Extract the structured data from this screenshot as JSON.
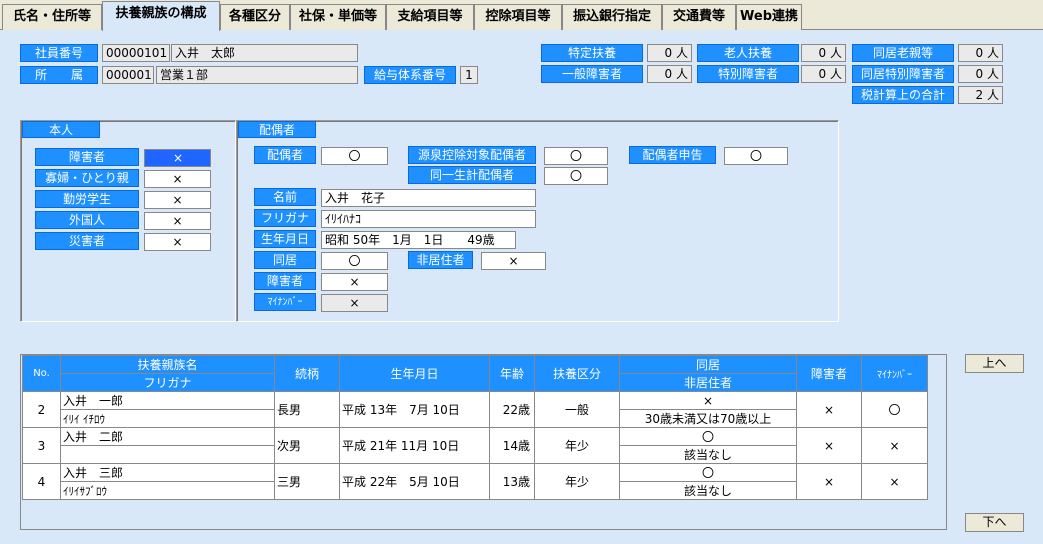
{
  "tabs": [
    "氏名・住所等",
    "扶養親族の構成",
    "各種区分",
    "社保・単価等",
    "支給項目等",
    "控除項目等",
    "振込銀行指定",
    "交通費等",
    "Web連携"
  ],
  "header": {
    "emp_no_label": "社員番号",
    "emp_no": "00000101",
    "emp_name": "入井　太郎",
    "dept_label": "所　　属",
    "dept_code": "000001",
    "dept_name": "営業１部",
    "pay_system_label": "給与体系番号",
    "pay_system": "1"
  },
  "counts": {
    "tokutei_label": "特定扶養",
    "tokutei": "0 人",
    "rojin_label": "老人扶養",
    "rojin": "0 人",
    "dokyo_rojin_label": "同居老親等",
    "dokyo_rojin": "0 人",
    "ippan_shogai_label": "一般障害者",
    "ippan_shogai": "0 人",
    "tokubetsu_shogai_label": "特別障害者",
    "tokubetsu_shogai": "0 人",
    "dokyo_tokubetsu_label": "同居特別障害者",
    "dokyo_tokubetsu": "0 人",
    "total_label": "税計算上の合計",
    "total": "2 人"
  },
  "honnin": {
    "title": "本人",
    "rows": [
      {
        "label": "障害者",
        "value": "×"
      },
      {
        "label": "寡婦・ひとり親",
        "value": "×"
      },
      {
        "label": "勤労学生",
        "value": "×"
      },
      {
        "label": "外国人",
        "value": "×"
      },
      {
        "label": "災害者",
        "value": "×"
      }
    ]
  },
  "spouse": {
    "title": "配偶者",
    "haigusha_label": "配偶者",
    "haigusha": "〇",
    "gensen_label": "源泉控除対象配偶者",
    "gensen": "〇",
    "shinkoku_label": "配偶者申告",
    "shinkoku": "〇",
    "doitsu_label": "同一生計配偶者",
    "doitsu": "〇",
    "name_label": "名前",
    "name": "入井　花子",
    "kana_label": "フリガナ",
    "kana": "ｲﾘｲﾊﾅｺ",
    "birth_label": "生年月日",
    "birth": "昭和 50年　1月　1日　　49歳",
    "dokyo_label": "同居",
    "dokyo": "〇",
    "hikyoju_label": "非居住者",
    "hikyoju": "×",
    "shogai_label": "障害者",
    "shogai": "×",
    "mynumber_label": "ﾏｲﾅﾝﾊﾞｰ",
    "mynumber": "×"
  },
  "family_table": {
    "headers": {
      "no": "No.",
      "name": "扶養親族名",
      "kana": "フリガナ",
      "relation": "続柄",
      "birth": "生年月日",
      "age": "年齢",
      "kubun": "扶養区分",
      "dokyo": "同居",
      "hikyoju": "非居住者",
      "shogai": "障害者",
      "mynumber": "ﾏｲﾅﾝﾊﾞｰ"
    },
    "rows": [
      {
        "no": "2",
        "name": "入井　一郎",
        "kana": "ｲﾘｲ ｲﾁﾛｳ",
        "relation": "長男",
        "birth": "平成 13年　7月 10日",
        "age": "22歳",
        "kubun": "一般",
        "dokyo": "×",
        "hikyoju": "30歳未満又は70歳以上",
        "shogai": "×",
        "mynumber": "〇"
      },
      {
        "no": "3",
        "name": "入井　二郎",
        "kana": "",
        "relation": "次男",
        "birth": "平成 21年 11月 10日",
        "age": "14歳",
        "kubun": "年少",
        "dokyo": "〇",
        "hikyoju": "該当なし",
        "shogai": "×",
        "mynumber": "×"
      },
      {
        "no": "4",
        "name": "入井　三郎",
        "kana": "ｲﾘｲｻﾌﾞﾛｳ",
        "relation": "三男",
        "birth": "平成 22年　5月 10日",
        "age": "13歳",
        "kubun": "年少",
        "dokyo": "〇",
        "hikyoju": "該当なし",
        "shogai": "×",
        "mynumber": "×"
      }
    ]
  },
  "buttons": {
    "up": "上へ",
    "down": "下へ"
  }
}
